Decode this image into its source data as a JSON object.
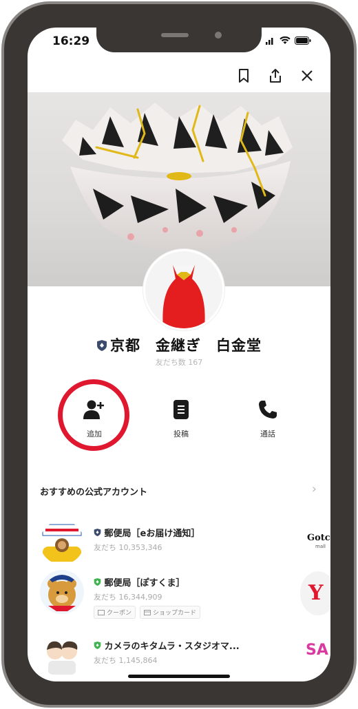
{
  "status_bar": {
    "time": "16:29"
  },
  "profile": {
    "name": "京都　金継ぎ　白金堂",
    "friends_count": "友だち数 167"
  },
  "actions": [
    {
      "label": "追加",
      "icon": "add-friend-icon"
    },
    {
      "label": "投稿",
      "icon": "post-icon"
    },
    {
      "label": "通話",
      "icon": "phone-icon"
    }
  ],
  "recommended": {
    "title": "おすすめの公式アカウント",
    "accounts": [
      {
        "name": "郵便局［eお届け通知］",
        "friends": "友だち 10,353,346",
        "badge_color": "#3c4a6e",
        "tags": []
      },
      {
        "name": "郵便局［ぽすくま］",
        "friends": "友だち 16,344,909",
        "badge_color": "#3fb34f",
        "tags": [
          "クーポン",
          "ショップカード"
        ]
      },
      {
        "name": "カメラのキタムラ・スタジオマ...",
        "friends": "友だち 1,145,864",
        "badge_color": "#3fb34f",
        "tags": []
      }
    ],
    "side_items": [
      {
        "text": "Gotch"
      },
      {
        "text": "mall"
      },
      {
        "text": "Y"
      },
      {
        "text": "SA"
      }
    ]
  },
  "colors": {
    "accent_red": "#e0182f",
    "official_badge": "#3c4a6e",
    "verified_badge": "#3fb34f"
  }
}
